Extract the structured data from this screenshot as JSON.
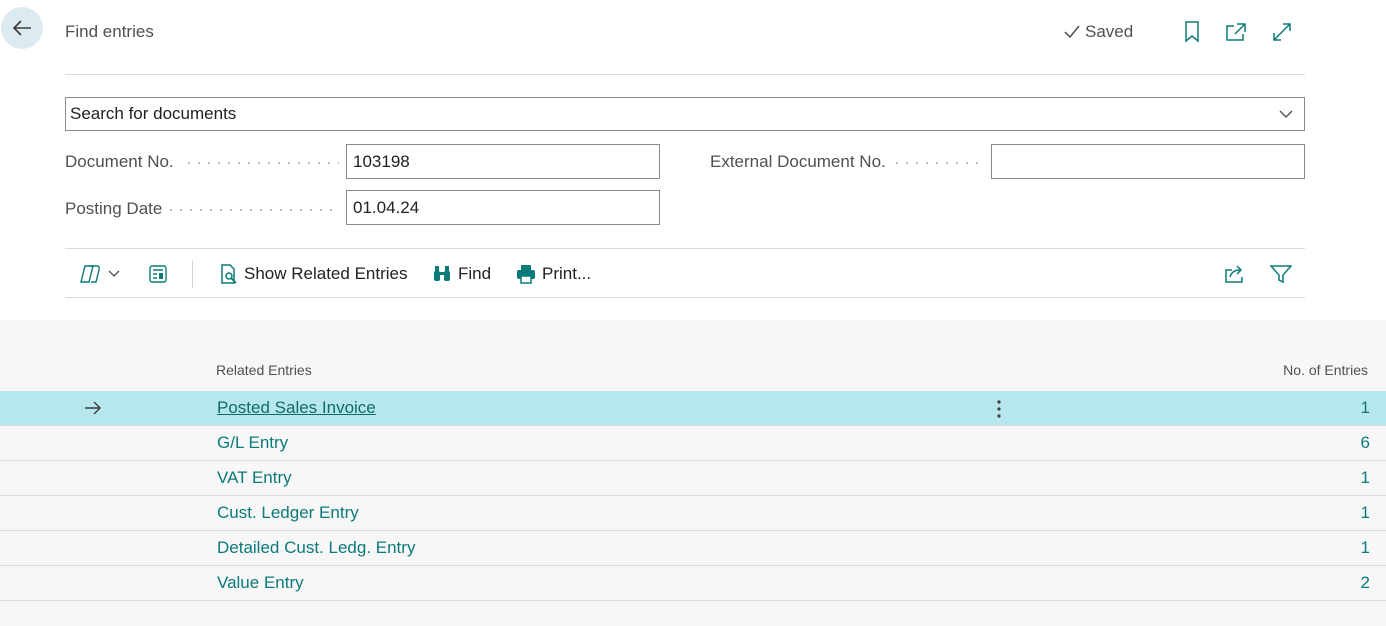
{
  "header": {
    "title": "Find entries",
    "saved_label": "Saved"
  },
  "search": {
    "selected": "Search for documents"
  },
  "fields": {
    "document_no_label": "Document No.",
    "document_no_value": "103198",
    "posting_date_label": "Posting Date",
    "posting_date_value": "01.04.24",
    "external_doc_label": "External Document No.",
    "external_doc_value": ""
  },
  "toolbar": {
    "show_related": "Show Related Entries",
    "find": "Find",
    "print": "Print..."
  },
  "grid": {
    "col_related": "Related Entries",
    "col_count": "No. of Entries",
    "rows": [
      {
        "name": "Posted Sales Invoice",
        "count": "1"
      },
      {
        "name": "G/L Entry",
        "count": "6"
      },
      {
        "name": "VAT Entry",
        "count": "1"
      },
      {
        "name": "Cust. Ledger Entry",
        "count": "1"
      },
      {
        "name": "Detailed Cust. Ledg. Entry",
        "count": "1"
      },
      {
        "name": "Value Entry",
        "count": "2"
      }
    ]
  },
  "colors": {
    "accent": "#0b7a7a",
    "selected_row": "#b5e7ec",
    "back_button": "#dcebef"
  }
}
